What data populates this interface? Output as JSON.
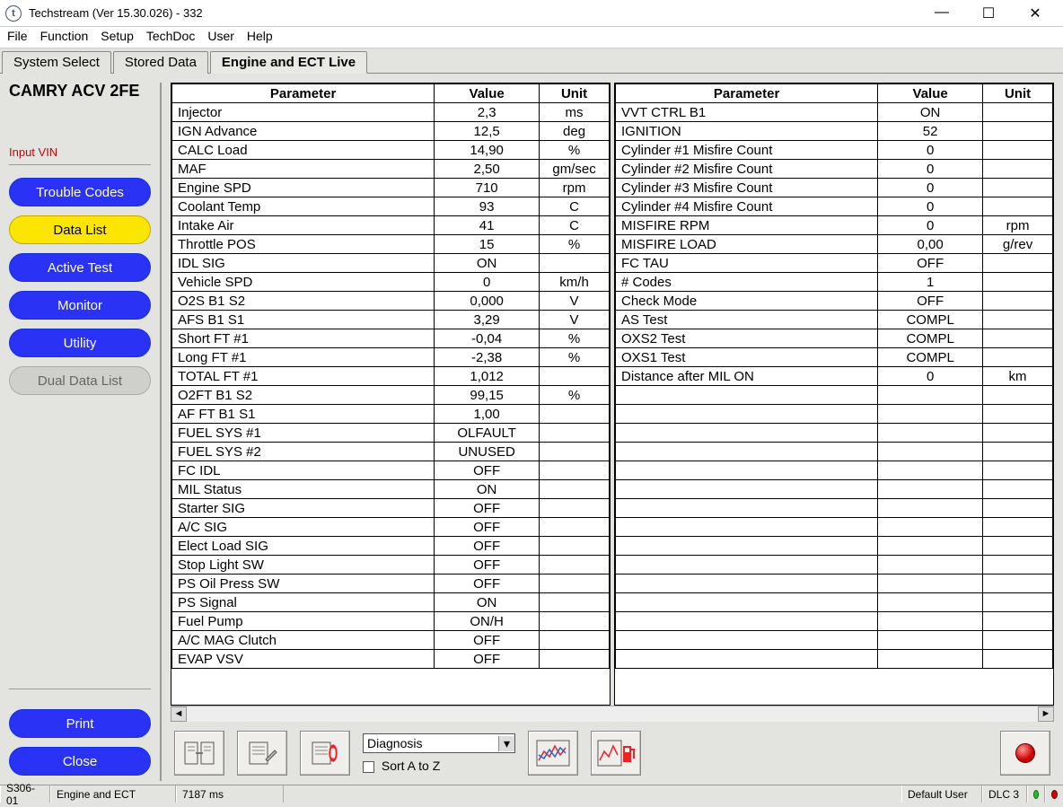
{
  "window_title": "Techstream (Ver 15.30.026) - 332",
  "menu": [
    "File",
    "Function",
    "Setup",
    "TechDoc",
    "User",
    "Help"
  ],
  "tabs": [
    "System Select",
    "Stored Data",
    "Engine and ECT Live"
  ],
  "vehicle": "CAMRY ACV 2FE",
  "input_vin": "Input VIN",
  "side_buttons": {
    "trouble": "Trouble Codes",
    "datalist": "Data List",
    "active": "Active Test",
    "monitor": "Monitor",
    "utility": "Utility",
    "dual": "Dual Data List",
    "print": "Print",
    "close": "Close"
  },
  "headers": {
    "param": "Parameter",
    "value": "Value",
    "unit": "Unit"
  },
  "left_rows": [
    {
      "p": "Injector",
      "v": "2,3",
      "u": "ms"
    },
    {
      "p": "IGN Advance",
      "v": "12,5",
      "u": "deg"
    },
    {
      "p": "CALC Load",
      "v": "14,90",
      "u": "%"
    },
    {
      "p": "MAF",
      "v": "2,50",
      "u": "gm/sec"
    },
    {
      "p": "Engine SPD",
      "v": "710",
      "u": "rpm"
    },
    {
      "p": "Coolant Temp",
      "v": "93",
      "u": "C"
    },
    {
      "p": "Intake Air",
      "v": "41",
      "u": "C"
    },
    {
      "p": "Throttle POS",
      "v": "15",
      "u": "%"
    },
    {
      "p": "IDL SIG",
      "v": "ON",
      "u": ""
    },
    {
      "p": "Vehicle SPD",
      "v": "0",
      "u": "km/h"
    },
    {
      "p": "O2S B1 S2",
      "v": "0,000",
      "u": "V"
    },
    {
      "p": "AFS B1 S1",
      "v": "3,29",
      "u": "V"
    },
    {
      "p": "Short FT #1",
      "v": "-0,04",
      "u": "%"
    },
    {
      "p": "Long FT #1",
      "v": "-2,38",
      "u": "%"
    },
    {
      "p": "TOTAL FT #1",
      "v": "1,012",
      "u": ""
    },
    {
      "p": "O2FT B1 S2",
      "v": "99,15",
      "u": "%"
    },
    {
      "p": "AF FT B1 S1",
      "v": "1,00",
      "u": ""
    },
    {
      "p": "FUEL SYS #1",
      "v": "OLFAULT",
      "u": ""
    },
    {
      "p": "FUEL SYS #2",
      "v": "UNUSED",
      "u": ""
    },
    {
      "p": "FC IDL",
      "v": "OFF",
      "u": ""
    },
    {
      "p": "MIL Status",
      "v": "ON",
      "u": ""
    },
    {
      "p": "Starter SIG",
      "v": "OFF",
      "u": ""
    },
    {
      "p": "A/C SIG",
      "v": "OFF",
      "u": ""
    },
    {
      "p": "Elect Load SIG",
      "v": "OFF",
      "u": ""
    },
    {
      "p": "Stop Light SW",
      "v": "OFF",
      "u": ""
    },
    {
      "p": "PS Oil Press SW",
      "v": "OFF",
      "u": ""
    },
    {
      "p": "PS Signal",
      "v": "ON",
      "u": ""
    },
    {
      "p": "Fuel Pump",
      "v": "ON/H",
      "u": ""
    },
    {
      "p": "A/C MAG Clutch",
      "v": "OFF",
      "u": ""
    },
    {
      "p": "EVAP VSV",
      "v": "OFF",
      "u": ""
    }
  ],
  "right_rows": [
    {
      "p": "VVT CTRL B1",
      "v": "ON",
      "u": ""
    },
    {
      "p": "IGNITION",
      "v": "52",
      "u": ""
    },
    {
      "p": "Cylinder #1 Misfire Count",
      "v": "0",
      "u": ""
    },
    {
      "p": "Cylinder #2 Misfire Count",
      "v": "0",
      "u": ""
    },
    {
      "p": "Cylinder #3 Misfire Count",
      "v": "0",
      "u": ""
    },
    {
      "p": "Cylinder #4 Misfire Count",
      "v": "0",
      "u": ""
    },
    {
      "p": "MISFIRE RPM",
      "v": "0",
      "u": "rpm"
    },
    {
      "p": "MISFIRE LOAD",
      "v": "0,00",
      "u": "g/rev"
    },
    {
      "p": "FC TAU",
      "v": "OFF",
      "u": ""
    },
    {
      "p": "# Codes",
      "v": "1",
      "u": ""
    },
    {
      "p": "Check Mode",
      "v": "OFF",
      "u": ""
    },
    {
      "p": "AS Test",
      "v": "COMPL",
      "u": ""
    },
    {
      "p": "OXS2 Test",
      "v": "COMPL",
      "u": ""
    },
    {
      "p": "OXS1 Test",
      "v": "COMPL",
      "u": ""
    },
    {
      "p": "Distance after MIL ON",
      "v": "0",
      "u": "km"
    },
    {
      "p": "",
      "v": "",
      "u": ""
    },
    {
      "p": "",
      "v": "",
      "u": ""
    },
    {
      "p": "",
      "v": "",
      "u": ""
    },
    {
      "p": "",
      "v": "",
      "u": ""
    },
    {
      "p": "",
      "v": "",
      "u": ""
    },
    {
      "p": "",
      "v": "",
      "u": ""
    },
    {
      "p": "",
      "v": "",
      "u": ""
    },
    {
      "p": "",
      "v": "",
      "u": ""
    },
    {
      "p": "",
      "v": "",
      "u": ""
    },
    {
      "p": "",
      "v": "",
      "u": ""
    },
    {
      "p": "",
      "v": "",
      "u": ""
    },
    {
      "p": "",
      "v": "",
      "u": ""
    },
    {
      "p": "",
      "v": "",
      "u": ""
    },
    {
      "p": "",
      "v": "",
      "u": ""
    },
    {
      "p": "",
      "v": "",
      "u": ""
    }
  ],
  "dropdown_value": "Diagnosis",
  "sort_label": "Sort A to Z",
  "status": {
    "code": "S306-01",
    "ecu": "Engine and ECT",
    "time": "7187 ms",
    "user": "Default User",
    "dlc": "DLC 3"
  }
}
